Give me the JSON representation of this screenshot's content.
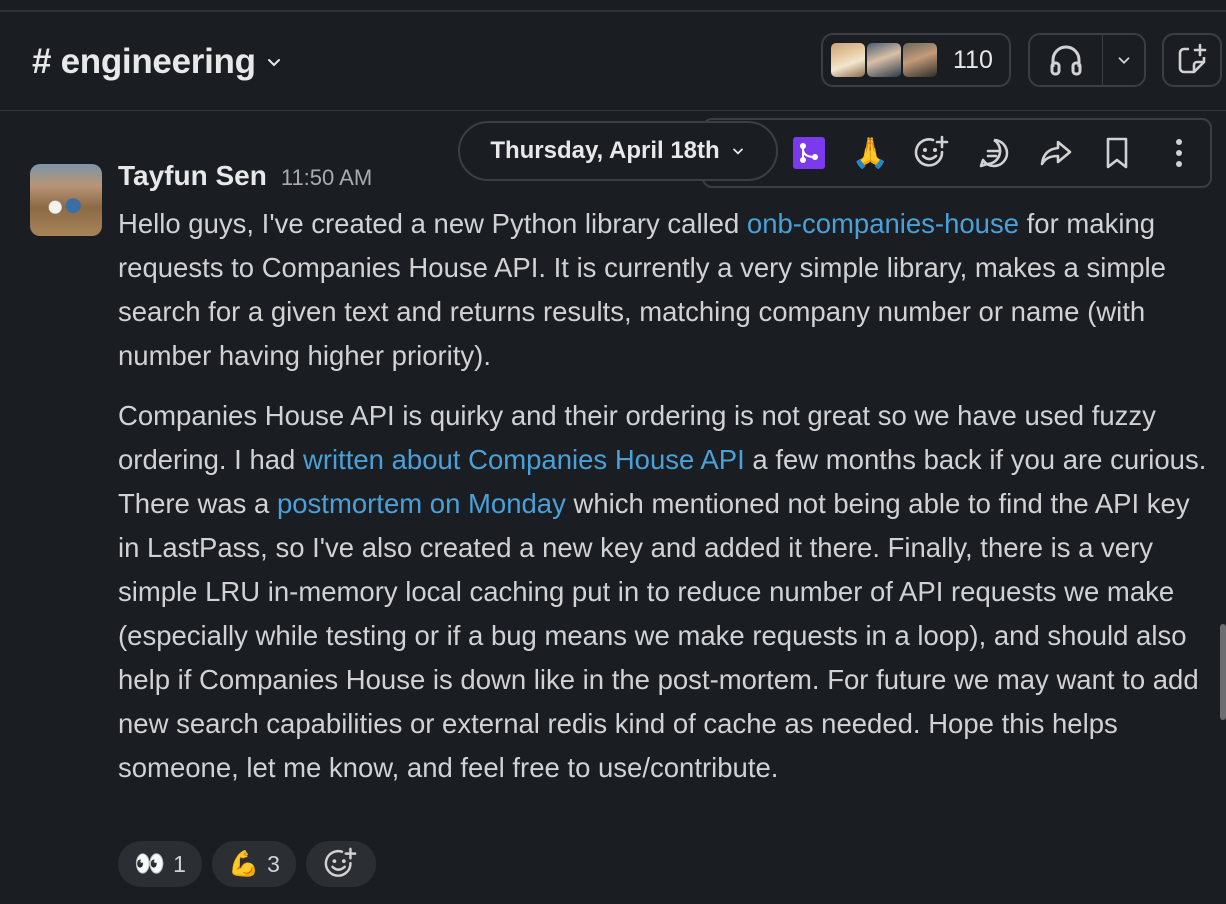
{
  "header": {
    "channel_hash": "#",
    "channel_name": "engineering",
    "member_count": "110"
  },
  "date_divider": {
    "label": "Thursday, April 18th"
  },
  "toolbar": {
    "quick_reaction": "🙏"
  },
  "message": {
    "author": "Tayfun Sen",
    "time": "11:50 AM",
    "p1_a": "Hello guys, I've created a new Python library called ",
    "p1_link": "onb-companies-house",
    "p1_b": " for making requests to Companies House API. It is currently a very simple library, makes a simple search for a given text and returns results, matching company number or name (with number having higher priority).",
    "p2_a": "Companies House API is quirky and their ordering is not great so we have used fuzzy ordering.  I had ",
    "p2_link1": "written about Companies House API",
    "p2_b": " a few months back if you are curious. There was a ",
    "p2_link2": "postmortem on Monday",
    "p2_c": " which mentioned not being able to find the API key in LastPass, so I've also created a new key and added it there. Finally, there is a very simple LRU in-memory local caching put in to reduce number of API requests we make (especially while testing or if a bug means we make requests in a loop), and should also help if Companies House is down like in the post-mortem. For future we may want to add new search capabilities or external redis kind of cache as needed. Hope this helps someone, let me know, and feel free to use/contribute."
  },
  "reactions": [
    {
      "emoji": "👀",
      "count": "1"
    },
    {
      "emoji": "💪",
      "count": "3"
    }
  ],
  "colors": {
    "background": "#1a1d21",
    "link": "#4aa0d8",
    "workflow_accent": "#7c3aed"
  }
}
